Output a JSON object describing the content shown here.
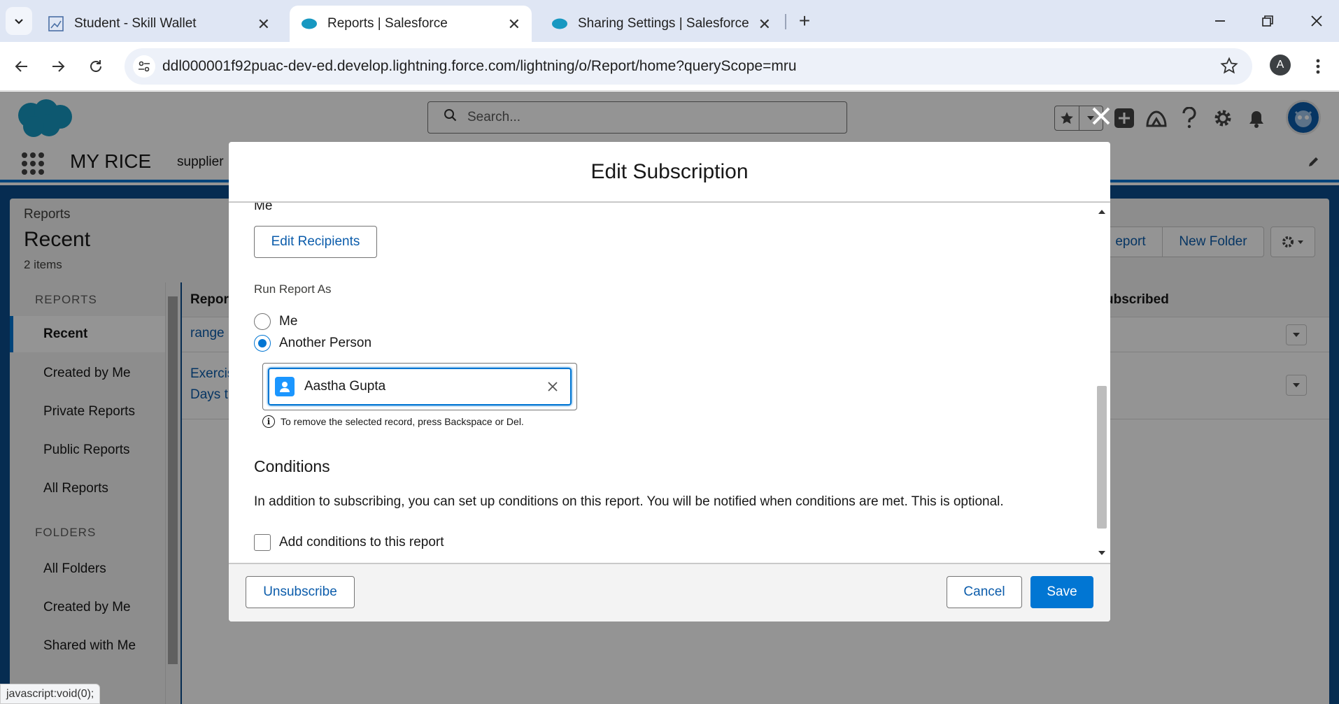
{
  "browser": {
    "tabs": [
      {
        "title": "Student - Skill Wallet",
        "icon": "skill-wallet-icon"
      },
      {
        "title": "Reports | Salesforce",
        "icon": "salesforce-cloud-icon"
      },
      {
        "title": "Sharing Settings | Salesforce",
        "icon": "salesforce-cloud-icon"
      }
    ],
    "url": "ddl000001f92puac-dev-ed.develop.lightning.force.com/lightning/o/Report/home?queryScope=mru",
    "profile_initial": "A",
    "status_text": "javascript:void(0);"
  },
  "sf": {
    "search_placeholder": "Search...",
    "app_name": "MY RICE",
    "nav_item": "supplier",
    "page_eyebrow": "Reports",
    "page_title": "Recent",
    "item_count": "2 items",
    "new_report_btn": "eport",
    "new_folder_btn": "New Folder",
    "sidebar": {
      "reports_heading": "REPORTS",
      "report_items": [
        "Recent",
        "Created by Me",
        "Private Reports",
        "Public Reports",
        "All Reports"
      ],
      "folders_heading": "FOLDERS",
      "folder_items": [
        "All Folders",
        "Created by Me",
        "Shared with Me"
      ]
    },
    "list": {
      "col_title": "Repor",
      "col_subscribed": "ubscribed",
      "rows": [
        {
          "line1": "range",
          "line2": ""
        },
        {
          "line1": "Exercis",
          "line2": "Days t"
        }
      ]
    }
  },
  "modal": {
    "title": "Edit Subscription",
    "recipients_value": "Me",
    "edit_recipients_label": "Edit Recipients",
    "run_as_label": "Run Report As",
    "run_as_options": [
      {
        "label": "Me",
        "selected": false
      },
      {
        "label": "Another Person",
        "selected": true
      }
    ],
    "selected_user": "Aastha Gupta",
    "help_text": "To remove the selected record, press Backspace or Del.",
    "conditions_title": "Conditions",
    "conditions_text": "In addition to subscribing, you can set up conditions on this report. You will be notified when conditions are met. This is optional.",
    "add_conditions_label": "Add conditions to this report",
    "add_conditions_checked": false,
    "unsubscribe_label": "Unsubscribe",
    "cancel_label": "Cancel",
    "save_label": "Save"
  },
  "colors": {
    "brand": "#0176d3",
    "link": "#0b5cab",
    "overlay": "rgba(0,0,0,0.42)",
    "page_background": "#0b4d8c"
  }
}
